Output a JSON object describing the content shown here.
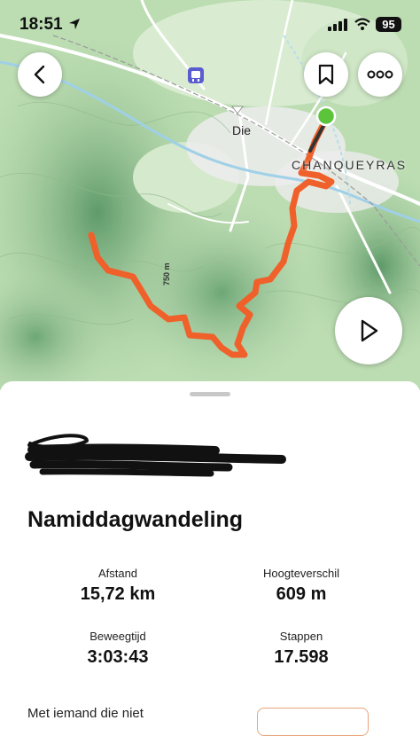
{
  "status_bar": {
    "time": "18:51",
    "battery": "95"
  },
  "map": {
    "labels": {
      "town_die": "Die",
      "town_chanqueyras": "CHANQUEYRAS",
      "contour": "750 m"
    },
    "route_color": "#f0602a",
    "start_marker_color": "#5cc43a"
  },
  "nav": {
    "back_icon": "chevron-left-icon",
    "bookmark_icon": "bookmark-icon",
    "more_icon": "more-dots-icon",
    "play_icon": "play-icon"
  },
  "activity": {
    "title": "Namiddagwandeling",
    "stats": [
      {
        "label": "Afstand",
        "value": "15,72 km"
      },
      {
        "label": "Hoogteverschil",
        "value": "609 m"
      },
      {
        "label": "Beweegtijd",
        "value": "3:03:43"
      },
      {
        "label": "Stappen",
        "value": "17.598"
      }
    ],
    "footer_text": "Met iemand die niet"
  }
}
